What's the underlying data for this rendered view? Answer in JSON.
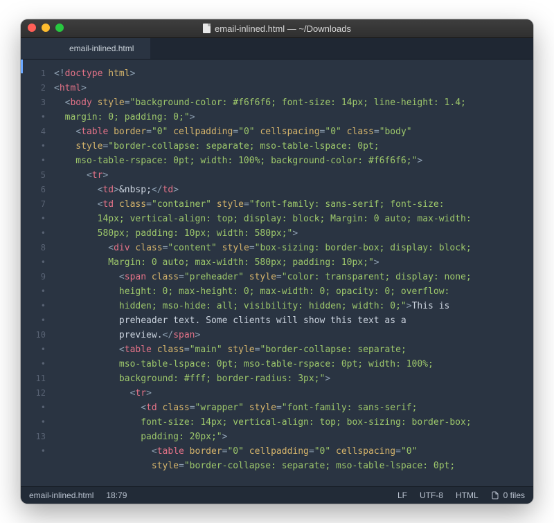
{
  "window": {
    "title": "email-inlined.html — ~/Downloads"
  },
  "tab": {
    "label": "email-inlined.html"
  },
  "gutter": {
    "lines": [
      "1",
      "2",
      "3",
      "•",
      "4",
      "•",
      "•",
      "5",
      "6",
      "7",
      "•",
      "•",
      "8",
      "•",
      "9",
      "•",
      "•",
      "•",
      "10",
      "•",
      "•",
      "11",
      "12",
      "•",
      "•",
      "13",
      "•"
    ]
  },
  "code": [
    [
      {
        "c": "p",
        "t": "<!"
      },
      {
        "c": "tg",
        "t": "doctype"
      },
      {
        "c": "at",
        "t": " html"
      },
      {
        "c": "p",
        "t": ">"
      }
    ],
    [
      {
        "c": "p",
        "t": "<"
      },
      {
        "c": "tg",
        "t": "html"
      },
      {
        "c": "p",
        "t": ">"
      }
    ],
    [
      {
        "c": "tx",
        "t": "  "
      },
      {
        "c": "p",
        "t": "<"
      },
      {
        "c": "tg",
        "t": "body"
      },
      {
        "c": "at",
        "t": " style"
      },
      {
        "c": "eq",
        "t": "="
      },
      {
        "c": "st",
        "t": "\"background-color: #f6f6f6; font-size: 14px; line-height: 1.4;"
      }
    ],
    [
      {
        "c": "st",
        "t": "  margin: 0; padding: 0;\""
      },
      {
        "c": "p",
        "t": ">"
      }
    ],
    [
      {
        "c": "tx",
        "t": "    "
      },
      {
        "c": "p",
        "t": "<"
      },
      {
        "c": "tg",
        "t": "table"
      },
      {
        "c": "at",
        "t": " border"
      },
      {
        "c": "eq",
        "t": "="
      },
      {
        "c": "st",
        "t": "\"0\""
      },
      {
        "c": "at",
        "t": " cellpadding"
      },
      {
        "c": "eq",
        "t": "="
      },
      {
        "c": "st",
        "t": "\"0\""
      },
      {
        "c": "at",
        "t": " cellspacing"
      },
      {
        "c": "eq",
        "t": "="
      },
      {
        "c": "st",
        "t": "\"0\""
      },
      {
        "c": "at",
        "t": " class"
      },
      {
        "c": "eq",
        "t": "="
      },
      {
        "c": "st",
        "t": "\"body\""
      }
    ],
    [
      {
        "c": "at",
        "t": "    style"
      },
      {
        "c": "eq",
        "t": "="
      },
      {
        "c": "st",
        "t": "\"border-collapse: separate; mso-table-lspace: 0pt;"
      }
    ],
    [
      {
        "c": "st",
        "t": "    mso-table-rspace: 0pt; width: 100%; background-color: #f6f6f6;\""
      },
      {
        "c": "p",
        "t": ">"
      }
    ],
    [
      {
        "c": "tx",
        "t": "      "
      },
      {
        "c": "p",
        "t": "<"
      },
      {
        "c": "tg",
        "t": "tr"
      },
      {
        "c": "p",
        "t": ">"
      }
    ],
    [
      {
        "c": "tx",
        "t": "        "
      },
      {
        "c": "p",
        "t": "<"
      },
      {
        "c": "tg",
        "t": "td"
      },
      {
        "c": "p",
        "t": ">"
      },
      {
        "c": "tx",
        "t": "&nbsp;"
      },
      {
        "c": "p",
        "t": "</"
      },
      {
        "c": "tg",
        "t": "td"
      },
      {
        "c": "p",
        "t": ">"
      }
    ],
    [
      {
        "c": "tx",
        "t": "        "
      },
      {
        "c": "p",
        "t": "<"
      },
      {
        "c": "tg",
        "t": "td"
      },
      {
        "c": "at",
        "t": " class"
      },
      {
        "c": "eq",
        "t": "="
      },
      {
        "c": "st",
        "t": "\"container\""
      },
      {
        "c": "at",
        "t": " style"
      },
      {
        "c": "eq",
        "t": "="
      },
      {
        "c": "st",
        "t": "\"font-family: sans-serif; font-size:"
      }
    ],
    [
      {
        "c": "st",
        "t": "        14px; vertical-align: top; display: block; Margin: 0 auto; max-width:"
      }
    ],
    [
      {
        "c": "st",
        "t": "        580px; padding: 10px; width: 580px;\""
      },
      {
        "c": "p",
        "t": ">"
      }
    ],
    [
      {
        "c": "tx",
        "t": "          "
      },
      {
        "c": "p",
        "t": "<"
      },
      {
        "c": "tg",
        "t": "div"
      },
      {
        "c": "at",
        "t": " class"
      },
      {
        "c": "eq",
        "t": "="
      },
      {
        "c": "st",
        "t": "\"content\""
      },
      {
        "c": "at",
        "t": " style"
      },
      {
        "c": "eq",
        "t": "="
      },
      {
        "c": "st",
        "t": "\"box-sizing: border-box; display: block;"
      }
    ],
    [
      {
        "c": "st",
        "t": "          Margin: 0 auto; max-width: 580px; padding: 10px;\""
      },
      {
        "c": "p",
        "t": ">"
      }
    ],
    [
      {
        "c": "tx",
        "t": "            "
      },
      {
        "c": "p",
        "t": "<"
      },
      {
        "c": "tg",
        "t": "span"
      },
      {
        "c": "at",
        "t": " class"
      },
      {
        "c": "eq",
        "t": "="
      },
      {
        "c": "st",
        "t": "\"preheader\""
      },
      {
        "c": "at",
        "t": " style"
      },
      {
        "c": "eq",
        "t": "="
      },
      {
        "c": "st",
        "t": "\"color: transparent; display: none;"
      }
    ],
    [
      {
        "c": "st",
        "t": "            height: 0; max-height: 0; max-width: 0; opacity: 0; overflow:"
      }
    ],
    [
      {
        "c": "st",
        "t": "            hidden; mso-hide: all; visibility: hidden; width: 0;\""
      },
      {
        "c": "p",
        "t": ">"
      },
      {
        "c": "tx",
        "t": "This is"
      }
    ],
    [
      {
        "c": "tx",
        "t": "            preheader text. Some clients will show this text as a"
      }
    ],
    [
      {
        "c": "tx",
        "t": "            preview."
      },
      {
        "c": "p",
        "t": "</"
      },
      {
        "c": "tg",
        "t": "span"
      },
      {
        "c": "p",
        "t": ">"
      }
    ],
    [
      {
        "c": "tx",
        "t": "            "
      },
      {
        "c": "p",
        "t": "<"
      },
      {
        "c": "tg",
        "t": "table"
      },
      {
        "c": "at",
        "t": " class"
      },
      {
        "c": "eq",
        "t": "="
      },
      {
        "c": "st",
        "t": "\"main\""
      },
      {
        "c": "at",
        "t": " style"
      },
      {
        "c": "eq",
        "t": "="
      },
      {
        "c": "st",
        "t": "\"border-collapse: separate;"
      }
    ],
    [
      {
        "c": "st",
        "t": "            mso-table-lspace: 0pt; mso-table-rspace: 0pt; width: 100%;"
      }
    ],
    [
      {
        "c": "st",
        "t": "            background: #fff; border-radius: 3px;\""
      },
      {
        "c": "p",
        "t": ">"
      }
    ],
    [
      {
        "c": "tx",
        "t": "              "
      },
      {
        "c": "p",
        "t": "<"
      },
      {
        "c": "tg",
        "t": "tr"
      },
      {
        "c": "p",
        "t": ">"
      }
    ],
    [
      {
        "c": "tx",
        "t": "                "
      },
      {
        "c": "p",
        "t": "<"
      },
      {
        "c": "tg",
        "t": "td"
      },
      {
        "c": "at",
        "t": " class"
      },
      {
        "c": "eq",
        "t": "="
      },
      {
        "c": "st",
        "t": "\"wrapper\""
      },
      {
        "c": "at",
        "t": " style"
      },
      {
        "c": "eq",
        "t": "="
      },
      {
        "c": "st",
        "t": "\"font-family: sans-serif;"
      }
    ],
    [
      {
        "c": "st",
        "t": "                font-size: 14px; vertical-align: top; box-sizing: border-box;"
      }
    ],
    [
      {
        "c": "st",
        "t": "                padding: 20px;\""
      },
      {
        "c": "p",
        "t": ">"
      }
    ],
    [
      {
        "c": "tx",
        "t": "                  "
      },
      {
        "c": "p",
        "t": "<"
      },
      {
        "c": "tg",
        "t": "table"
      },
      {
        "c": "at",
        "t": " border"
      },
      {
        "c": "eq",
        "t": "="
      },
      {
        "c": "st",
        "t": "\"0\""
      },
      {
        "c": "at",
        "t": " cellpadding"
      },
      {
        "c": "eq",
        "t": "="
      },
      {
        "c": "st",
        "t": "\"0\""
      },
      {
        "c": "at",
        "t": " cellspacing"
      },
      {
        "c": "eq",
        "t": "="
      },
      {
        "c": "st",
        "t": "\"0\""
      }
    ],
    [
      {
        "c": "at",
        "t": "                  style"
      },
      {
        "c": "eq",
        "t": "="
      },
      {
        "c": "st",
        "t": "\"border-collapse: separate; mso-table-lspace: 0pt;"
      }
    ]
  ],
  "status": {
    "filename": "email-inlined.html",
    "cursor": "18:79",
    "line_ending": "LF",
    "encoding": "UTF-8",
    "language": "HTML",
    "files": "0 files"
  }
}
